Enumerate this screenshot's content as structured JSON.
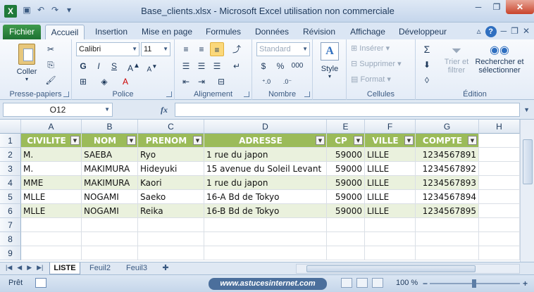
{
  "window": {
    "title": "Base_clients.xlsx - Microsoft Excel utilisation non commerciale"
  },
  "qat_icons": [
    "save-icon",
    "undo-icon",
    "redo-icon",
    "customize-icon"
  ],
  "ribbon_tabs": [
    "Fichier",
    "Accueil",
    "Insertion",
    "Mise en page",
    "Formules",
    "Données",
    "Révision",
    "Affichage",
    "Développeur"
  ],
  "active_tab": "Accueil",
  "ribbon": {
    "clipboard": {
      "label": "Presse-papiers",
      "paste": "Coller"
    },
    "font": {
      "label": "Police",
      "name": "Calibri",
      "size": "11",
      "bold": "G",
      "italic": "I",
      "underline": "S"
    },
    "alignment": {
      "label": "Alignement"
    },
    "number": {
      "label": "Nombre",
      "format": "Standard",
      "currency": "$",
      "percent": "%",
      "thousands": "000"
    },
    "styles": {
      "label": "Style"
    },
    "cells": {
      "label": "Cellules",
      "insert": "Insérer",
      "delete": "Supprimer",
      "format": "Format"
    },
    "editing": {
      "label": "Édition",
      "sort1": "Trier et",
      "sort2": "filtrer",
      "find1": "Rechercher et",
      "find2": "sélectionner"
    }
  },
  "formula_bar": {
    "name_box": "O12",
    "fx": "fx",
    "formula": ""
  },
  "columns": [
    "A",
    "B",
    "C",
    "D",
    "E",
    "F",
    "G",
    "H"
  ],
  "rows": [
    "1",
    "2",
    "3",
    "4",
    "5",
    "6",
    "7",
    "8",
    "9"
  ],
  "table": {
    "headers": [
      "CIVILITE",
      "NOM",
      "PRENOM",
      "ADRESSE",
      "CP",
      "VILLE",
      "COMPTE"
    ],
    "data": [
      [
        "M.",
        "SAEBA",
        "Ryo",
        "1 rue du japon",
        "59000",
        "LILLE",
        "1234567891"
      ],
      [
        "M.",
        "MAKIMURA",
        "Hideyuki",
        "15 avenue du Soleil Levant",
        "59000",
        "LILLE",
        "1234567892"
      ],
      [
        "MME",
        "MAKIMURA",
        "Kaori",
        "1 rue du japon",
        "59000",
        "LILLE",
        "1234567893"
      ],
      [
        "MLLE",
        "NOGAMI",
        "Saeko",
        "16-A Bd de Tokyo",
        "59000",
        "LILLE",
        "1234567894"
      ],
      [
        "MLLE",
        "NOGAMI",
        "Reika",
        "16-B Bd de Tokyo",
        "59000",
        "LILLE",
        "1234567895"
      ]
    ],
    "header_color": "#9bbb59",
    "band_color": "#eaf1dd"
  },
  "sheets": [
    "LISTE",
    "Feuil2",
    "Feuil3"
  ],
  "active_sheet": "LISTE",
  "status": {
    "ready": "Prêt",
    "watermark": "www.astucesinternet.com",
    "zoom": "100 %",
    "zoom_level": 1.0
  }
}
